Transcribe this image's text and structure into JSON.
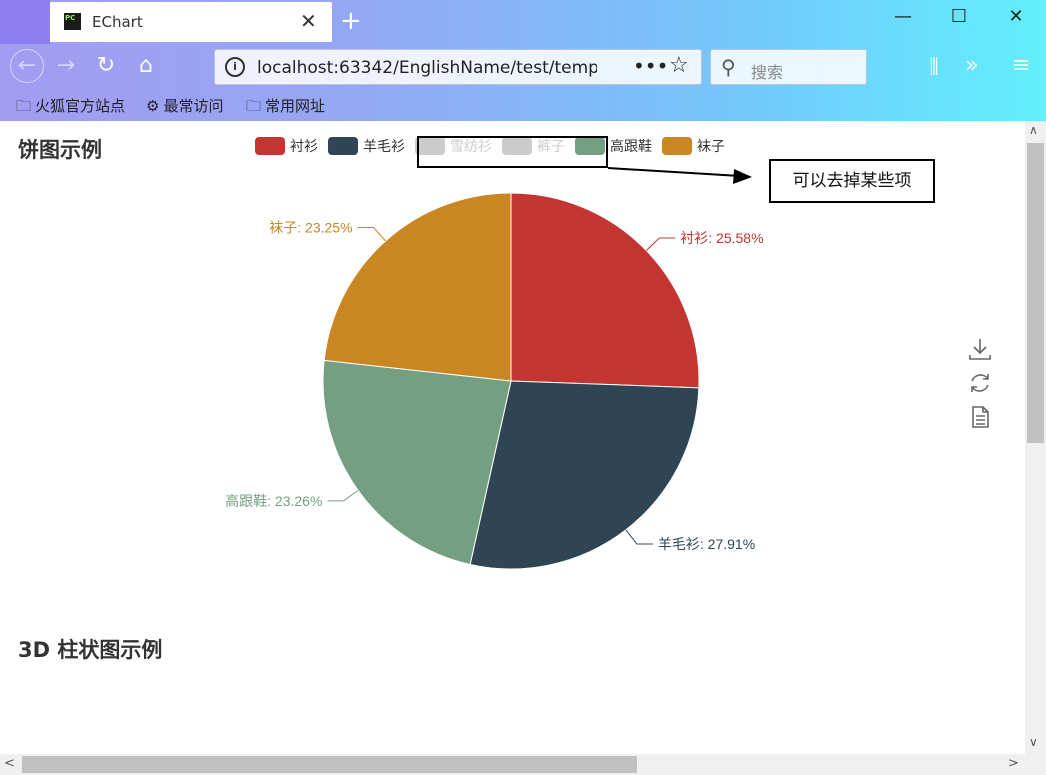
{
  "browser": {
    "tab_title": "EChart",
    "url": "localhost:63342/EnglishName/test/temp",
    "search_placeholder": "搜索",
    "bookmarks": [
      "火狐官方站点",
      "最常访问",
      "常用网址"
    ]
  },
  "page": {
    "section1_title": "饼图示例",
    "section2_title": "3D 柱状图示例",
    "annotation": "可以去掉某些项"
  },
  "chart_data": {
    "type": "pie",
    "legend": [
      {
        "name": "衬衫",
        "color": "#c23531",
        "selected": true
      },
      {
        "name": "羊毛衫",
        "color": "#2f4554",
        "selected": true
      },
      {
        "name": "雪纺衫",
        "color": "#61a0a8",
        "selected": false
      },
      {
        "name": "裤子",
        "color": "#d48265",
        "selected": false
      },
      {
        "name": "高跟鞋",
        "color": "#749f83",
        "selected": true
      },
      {
        "name": "袜子",
        "color": "#ca8622",
        "selected": true
      }
    ],
    "slices": [
      {
        "name": "衬衫",
        "percent": 25.58,
        "label": "衬衫: 25.58%",
        "color": "#c23531"
      },
      {
        "name": "羊毛衫",
        "percent": 27.91,
        "label": "羊毛衫: 27.91%",
        "color": "#2f4554"
      },
      {
        "name": "高跟鞋",
        "percent": 23.26,
        "label": "高跟鞋: 23.26%",
        "color": "#749f83"
      },
      {
        "name": "袜子",
        "percent": 23.25,
        "label": "袜子: 23.25%",
        "color": "#ca8622"
      }
    ]
  }
}
